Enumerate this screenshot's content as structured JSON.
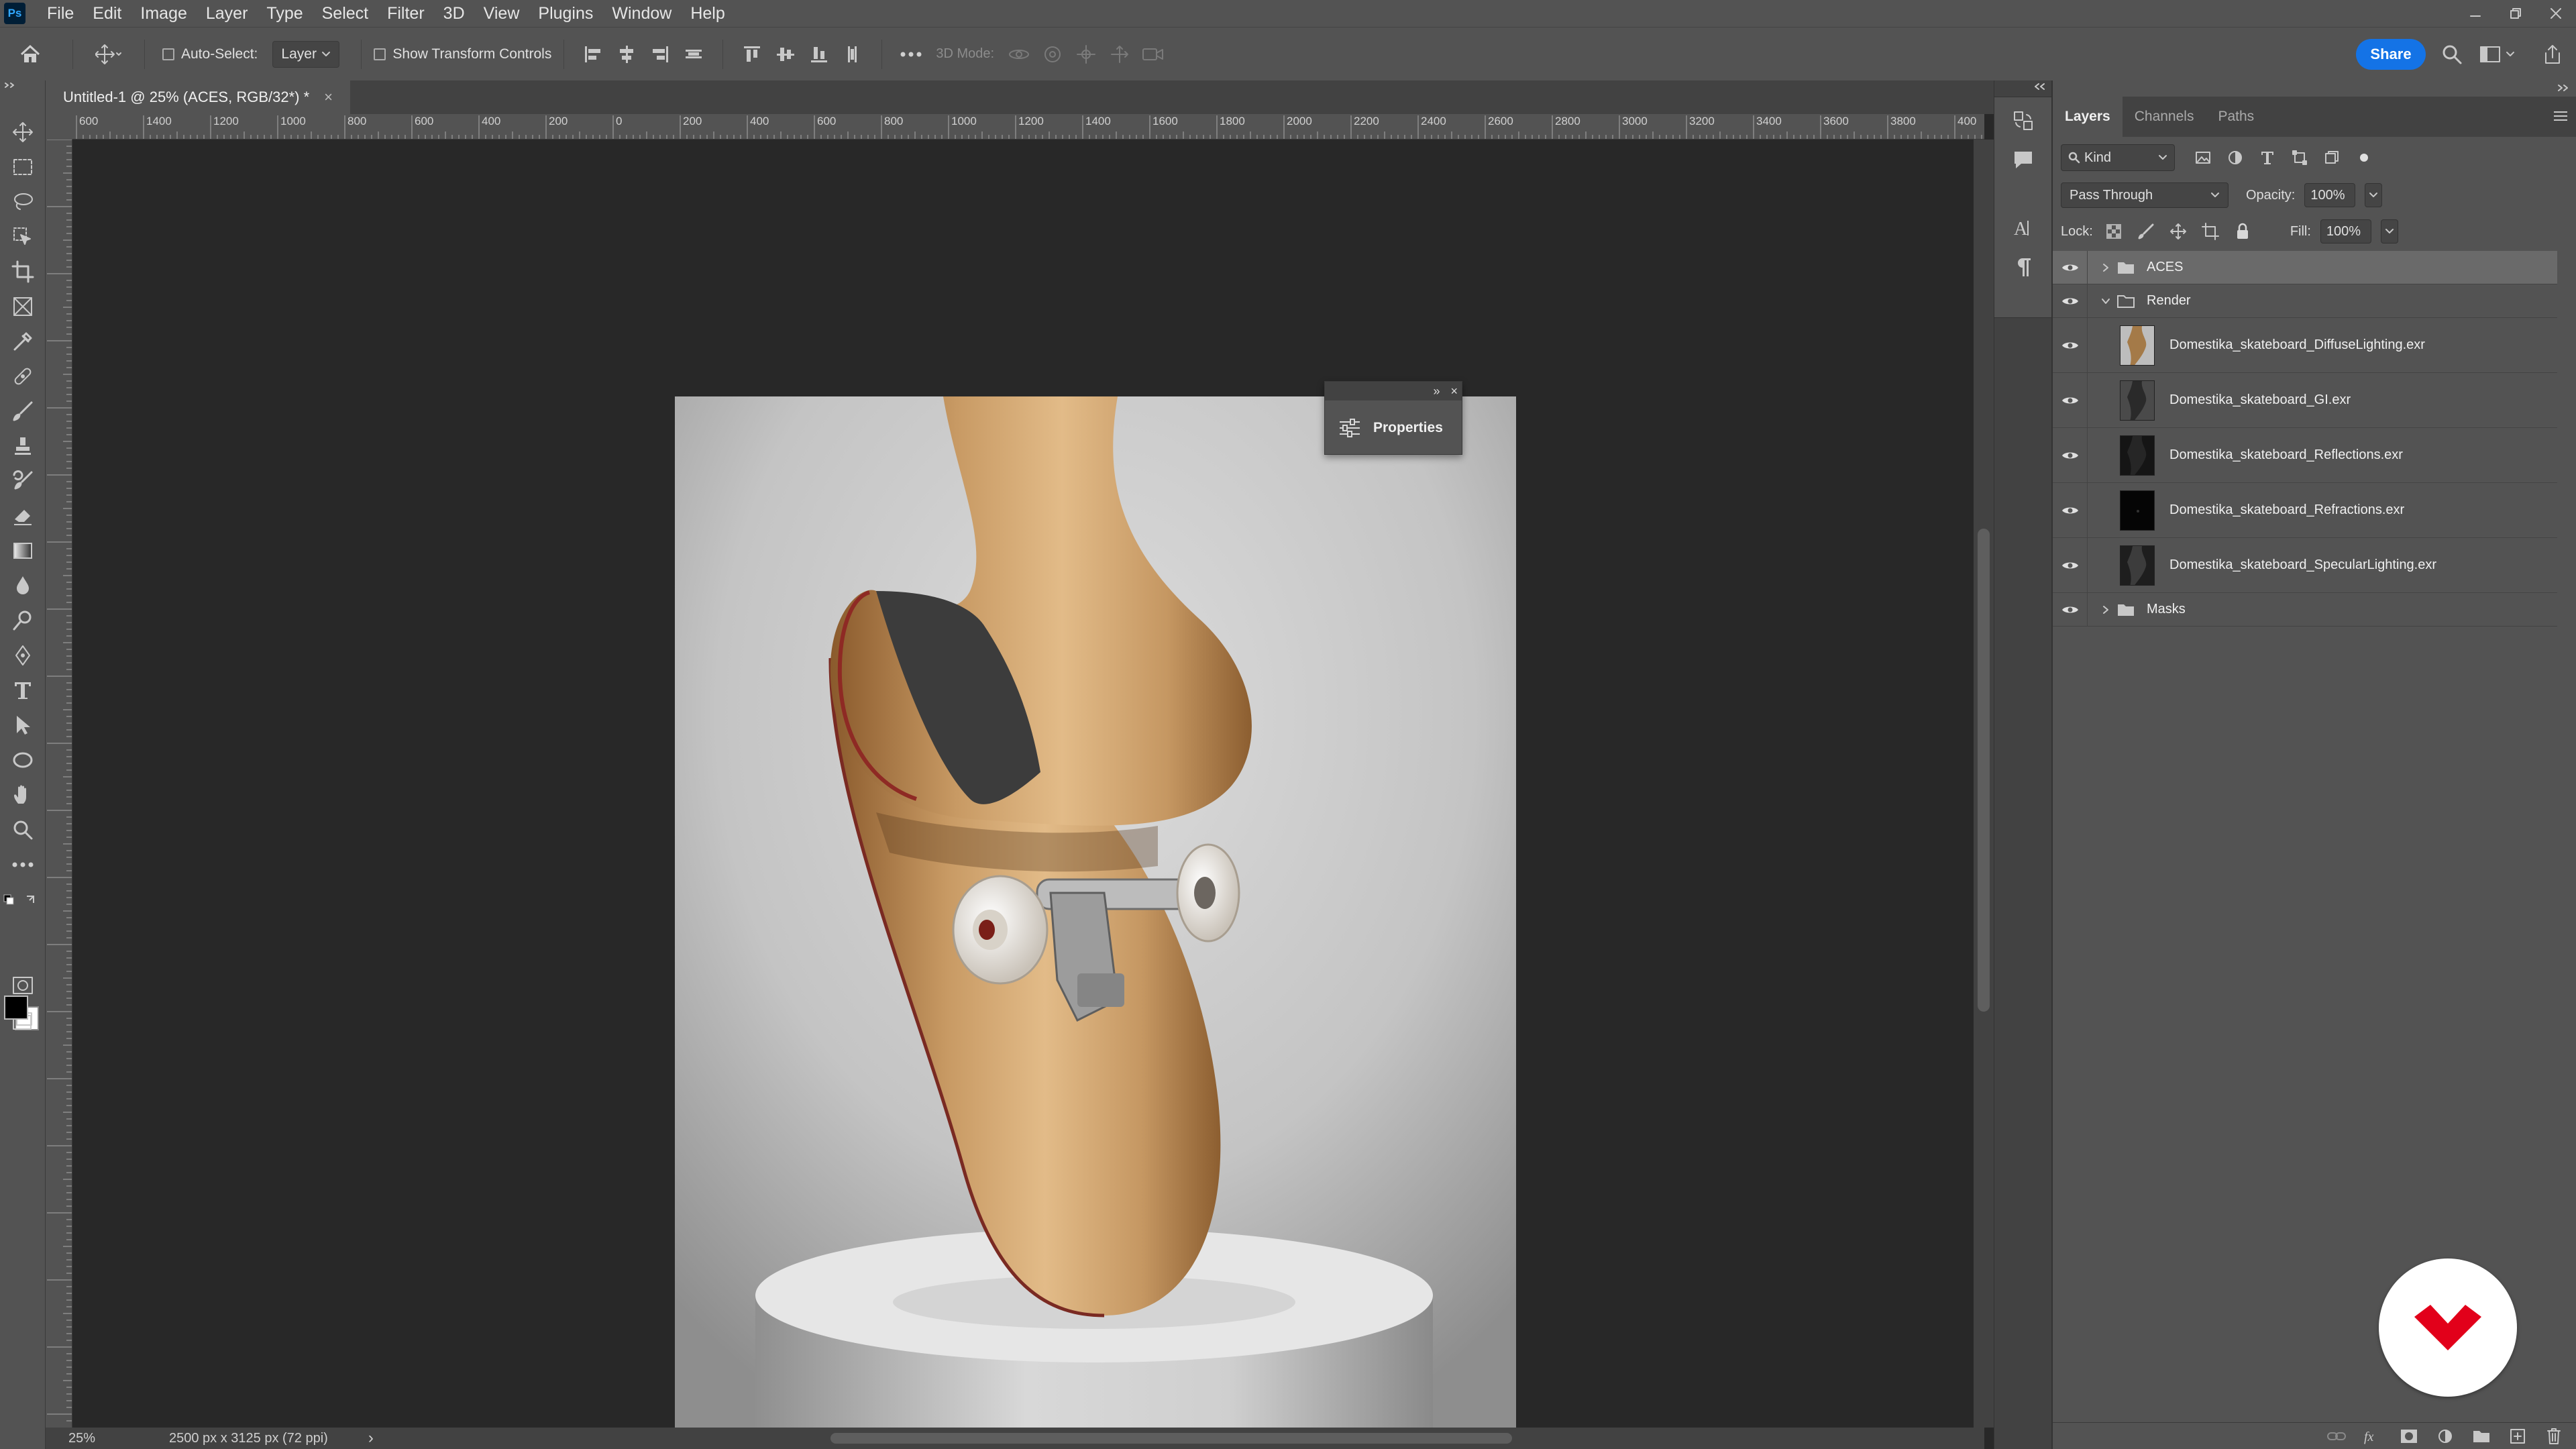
{
  "menubar": {
    "logo": "Ps",
    "items": [
      "File",
      "Edit",
      "Image",
      "Layer",
      "Type",
      "Select",
      "Filter",
      "3D",
      "View",
      "Plugins",
      "Window",
      "Help"
    ]
  },
  "options": {
    "auto_select_label": "Auto-Select:",
    "auto_select_value": "Layer",
    "show_transform_label": "Show Transform Controls",
    "mode_3d_label": "3D Mode:",
    "share_label": "Share"
  },
  "document": {
    "tab_title": "Untitled-1 @ 25% (ACES, RGB/32*) *",
    "tab_close": "×"
  },
  "ruler": {
    "h_labels": [
      "600",
      "1400",
      "1200",
      "1000",
      "800",
      "600",
      "400",
      "200",
      "0",
      "200",
      "400",
      "600",
      "800",
      "1000",
      "1200",
      "1400",
      "1600",
      "1800",
      "2000",
      "2200",
      "2400",
      "2600",
      "2800",
      "3000",
      "3200",
      "3400",
      "3600",
      "3800",
      "400"
    ]
  },
  "properties_panel": {
    "title": "Properties",
    "collapse": "»",
    "close": "×"
  },
  "status": {
    "zoom": "25%",
    "doc_info": "2500 px x 3125 px (72 ppi)",
    "arrow": "›"
  },
  "layers_panel": {
    "tabs": [
      "Layers",
      "Channels",
      "Paths"
    ],
    "filter_kind": "Kind",
    "blend_mode": "Pass Through",
    "opacity_label": "Opacity:",
    "opacity_value": "100%",
    "lock_label": "Lock:",
    "fill_label": "Fill:",
    "fill_value": "100%",
    "layers": [
      {
        "name": "ACES",
        "kind": "group",
        "expanded": false,
        "selected": true
      },
      {
        "name": "Render",
        "kind": "group",
        "expanded": true,
        "selected": false
      },
      {
        "name": "Domestika_skateboard_DiffuseLighting.exr",
        "kind": "image"
      },
      {
        "name": "Domestika_skateboard_GI.exr",
        "kind": "image"
      },
      {
        "name": "Domestika_skateboard_Reflections.exr",
        "kind": "image"
      },
      {
        "name": "Domestika_skateboard_Refractions.exr",
        "kind": "image"
      },
      {
        "name": "Domestika_skateboard_SpecularLighting.exr",
        "kind": "image"
      },
      {
        "name": "Masks",
        "kind": "group",
        "expanded": false,
        "selected": false
      }
    ]
  },
  "colors": {
    "share": "#1473e6",
    "brand_red": "#e2001a",
    "panel_bg": "#535353",
    "canvas_bg": "#282828"
  }
}
